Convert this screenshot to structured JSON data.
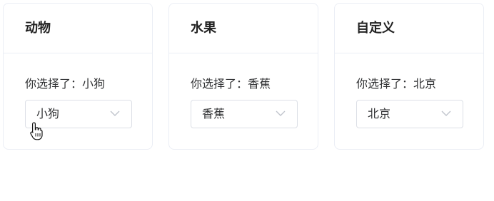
{
  "cards": [
    {
      "title": "动物",
      "result_prefix": "你选择了：",
      "selected_value": "小狗",
      "select_display": "小狗"
    },
    {
      "title": "水果",
      "result_prefix": "你选择了：",
      "selected_value": "香蕉",
      "select_display": "香蕉"
    },
    {
      "title": "自定义",
      "result_prefix": "你选择了：",
      "selected_value": "北京",
      "select_display": "北京"
    }
  ],
  "icons": {
    "dropdown": "chevron-down-icon",
    "pointer": "hand-pointer-cursor"
  },
  "colors": {
    "border": "#ebeef5",
    "select_border": "#dcdfe6",
    "text": "#303133",
    "chevron": "#c0c4cc"
  }
}
